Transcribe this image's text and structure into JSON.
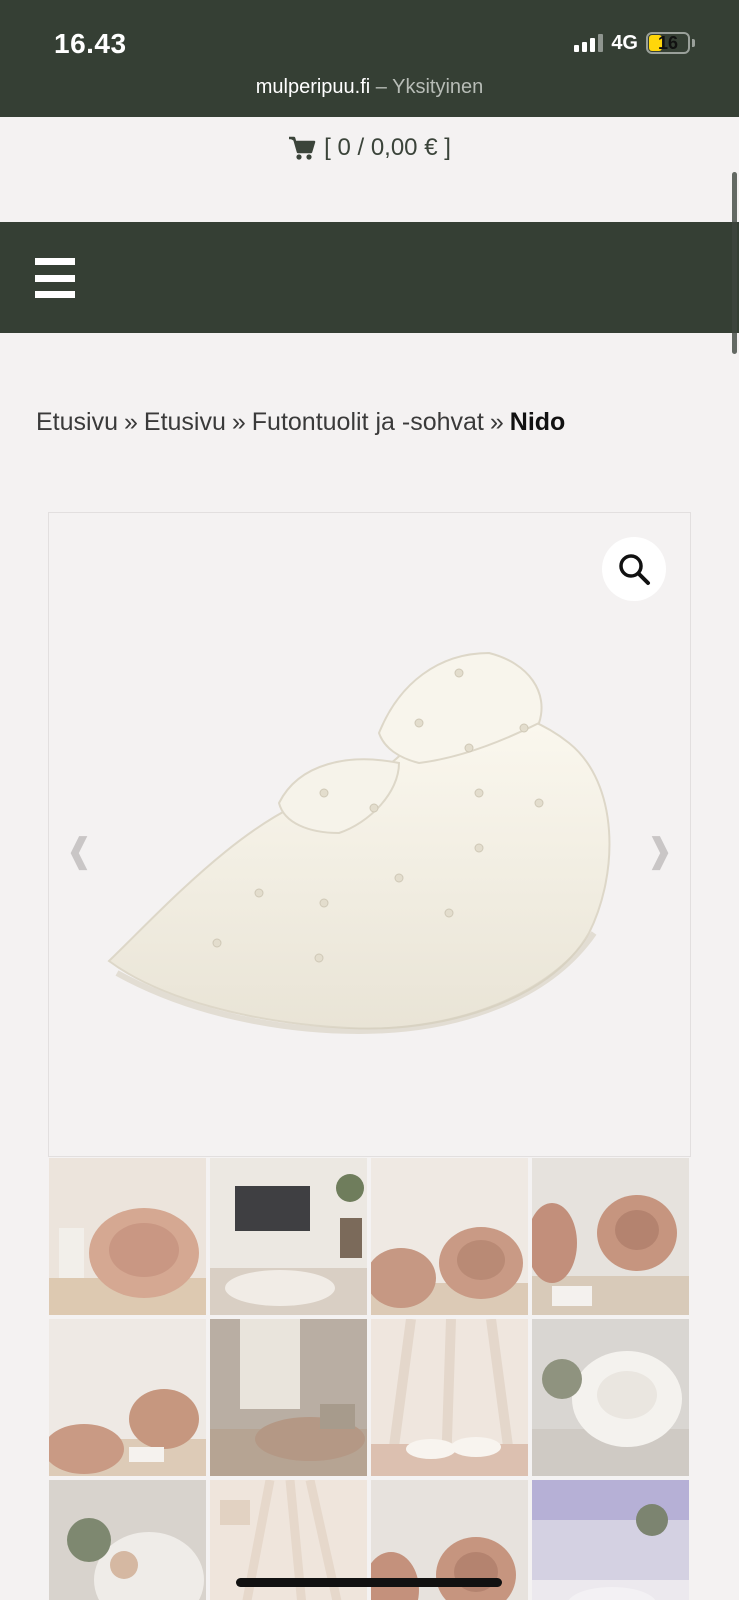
{
  "status": {
    "time": "16.43",
    "network": "4G",
    "battery": "16"
  },
  "browser": {
    "host": "mulperipuu.fi",
    "mode": "– Yksityinen"
  },
  "cart": {
    "label": "[ 0 / 0,00 € ]",
    "icon": "cart-icon"
  },
  "nav": {
    "menu_icon": "hamburger-menu-icon"
  },
  "breadcrumb": {
    "items": [
      "Etusivu",
      "Etusivu",
      "Futontuolit ja -sohvat"
    ],
    "separator": "»",
    "current": "Nido"
  },
  "gallery": {
    "zoom_icon": "magnifier-icon",
    "prev": "❰",
    "next": "❱",
    "thumbnail_count": 12
  },
  "colors": {
    "header": "#353f34",
    "background": "#f4f2f2",
    "battery_low": "#ffd60a"
  }
}
